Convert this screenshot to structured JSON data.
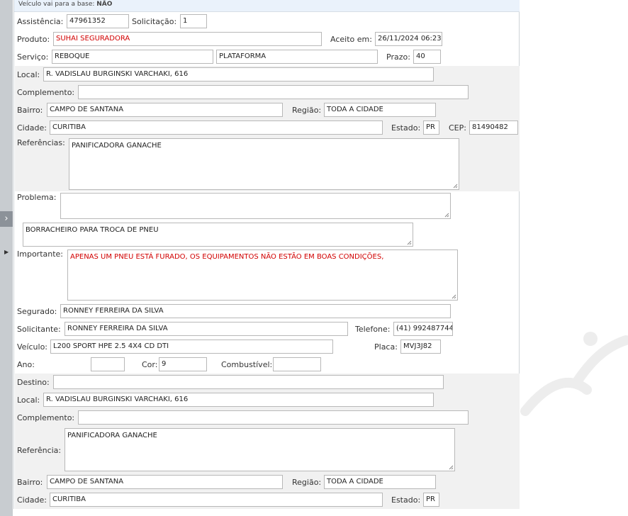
{
  "topbar": {
    "veiculo_base_label": "Veículo vai para a base:",
    "veiculo_base_value": "NÃO"
  },
  "assistencia": {
    "label": "Assistência:",
    "value": "47961352"
  },
  "solicitacao": {
    "label": "Solicitação:",
    "value": "1"
  },
  "produto": {
    "label": "Produto:",
    "value": "SUHAI SEGURADORA"
  },
  "aceito": {
    "label": "Aceito em:",
    "value": "26/11/2024 06:23"
  },
  "servico": {
    "label": "Serviço:",
    "value1": "REBOQUE",
    "value2": "PLATAFORMA"
  },
  "prazo": {
    "label": "Prazo:",
    "value": "40"
  },
  "origem": {
    "local": {
      "label": "Local:",
      "value": "R. VADISLAU BURGINSKI VARCHAKI, 616"
    },
    "complemento": {
      "label": "Complemento:",
      "value": ""
    },
    "bairro": {
      "label": "Bairro:",
      "value": "CAMPO DE SANTANA"
    },
    "regiao": {
      "label": "Região:",
      "value": "TODA A CIDADE"
    },
    "cidade": {
      "label": "Cidade:",
      "value": "CURITIBA"
    },
    "estado": {
      "label": "Estado:",
      "value": "PR"
    },
    "cep": {
      "label": "CEP:",
      "value": "81490482"
    },
    "referencias": {
      "label": "Referências:",
      "value": "PANIFICADORA GANACHE"
    }
  },
  "problema": {
    "label": "Problema:",
    "value": "",
    "detalhe": "BORRACHEIRO PARA TROCA DE PNEU"
  },
  "importante": {
    "label": "Importante:",
    "value": "APENAS UM PNEU ESTÁ FURADO, OS EQUIPAMENTOS NÃO ESTÃO EM BOAS CONDIÇÕES,"
  },
  "segurado": {
    "label": "Segurado:",
    "value": "RONNEY FERREIRA DA SILVA"
  },
  "solicitante": {
    "label": "Solicitante:",
    "value": "RONNEY FERREIRA DA SILVA"
  },
  "telefone": {
    "label": "Telefone:",
    "value": "(41) 992487744"
  },
  "veiculo": {
    "label": "Veículo:",
    "value": "L200 SPORT HPE 2.5 4X4 CD DTI"
  },
  "placa": {
    "label": "Placa:",
    "value": "MVJ3J82"
  },
  "ano": {
    "label": "Ano:",
    "value": ""
  },
  "cor": {
    "label": "Cor:",
    "value": "9"
  },
  "combustivel": {
    "label": "Combustível:",
    "value": ""
  },
  "destino": {
    "destino": {
      "label": "Destino:",
      "value": ""
    },
    "local": {
      "label": "Local:",
      "value": "R. VADISLAU BURGINSKI VARCHAKI, 616"
    },
    "complemento": {
      "label": "Complemento:",
      "value": ""
    },
    "referencia": {
      "label": "Referência:",
      "value": "PANIFICADORA GANACHE"
    },
    "bairro": {
      "label": "Bairro:",
      "value": "CAMPO DE SANTANA"
    },
    "regiao": {
      "label": "Região:",
      "value": "TODA A CIDADE"
    },
    "cidade": {
      "label": "Cidade:",
      "value": "CURITIBA"
    },
    "estado": {
      "label": "Estado:",
      "value": "PR"
    }
  },
  "icons": {
    "expand": "chevron-right-icon",
    "row_marker": "triangle-right-icon"
  },
  "colors": {
    "highlight_text": "#d20000",
    "band_bg": "#f1f1f1",
    "topbar_bg": "#eaf2fb"
  }
}
